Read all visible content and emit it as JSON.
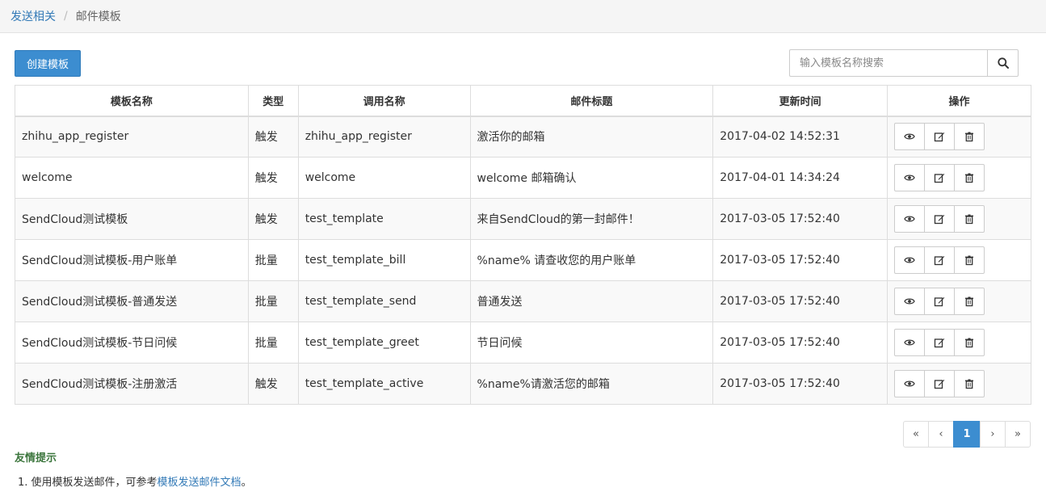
{
  "breadcrumb": {
    "parent": "发送相关",
    "separator": "/",
    "current": "邮件模板"
  },
  "toolbar": {
    "create_label": "创建模板"
  },
  "search": {
    "placeholder": "输入模板名称搜索",
    "icon": "search-icon"
  },
  "table": {
    "headers": [
      "模板名称",
      "类型",
      "调用名称",
      "邮件标题",
      "更新时间",
      "操作"
    ],
    "rows": [
      {
        "name": "zhihu_app_register",
        "type": "触发",
        "call_name": "zhihu_app_register",
        "subject": "激活你的邮箱",
        "updated": "2017-04-02 14:52:31"
      },
      {
        "name": "welcome",
        "type": "触发",
        "call_name": "welcome",
        "subject": "welcome 邮箱确认",
        "updated": "2017-04-01 14:34:24"
      },
      {
        "name": "SendCloud测试模板",
        "type": "触发",
        "call_name": "test_template",
        "subject": "来自SendCloud的第一封邮件！",
        "updated": "2017-03-05 17:52:40"
      },
      {
        "name": "SendCloud测试模板-用户账单",
        "type": "批量",
        "call_name": "test_template_bill",
        "subject": "%name% 请查收您的用户账单",
        "updated": "2017-03-05 17:52:40"
      },
      {
        "name": "SendCloud测试模板-普通发送",
        "type": "批量",
        "call_name": "test_template_send",
        "subject": "普通发送",
        "updated": "2017-03-05 17:52:40"
      },
      {
        "name": "SendCloud测试模板-节日问候",
        "type": "批量",
        "call_name": "test_template_greet",
        "subject": "节日问候",
        "updated": "2017-03-05 17:52:40"
      },
      {
        "name": "SendCloud测试模板-注册激活",
        "type": "触发",
        "call_name": "test_template_active",
        "subject": "%name%请激活您的邮箱",
        "updated": "2017-03-05 17:52:40"
      }
    ],
    "row_actions": [
      "eye-icon",
      "edit-icon",
      "trash-icon"
    ]
  },
  "pagination": {
    "first": "«",
    "prev": "‹",
    "current": "1",
    "next": "›",
    "last": "»"
  },
  "tips": {
    "title": "友情提示",
    "line_prefix": "1. 使用模板发送邮件，可参考",
    "link_text": "模板发送邮件文档",
    "line_suffix": "。"
  },
  "colors": {
    "primary": "#3c8dd0",
    "link": "#337ab7",
    "tips_title": "#3c763d",
    "stripe": "#f9f9f9"
  }
}
